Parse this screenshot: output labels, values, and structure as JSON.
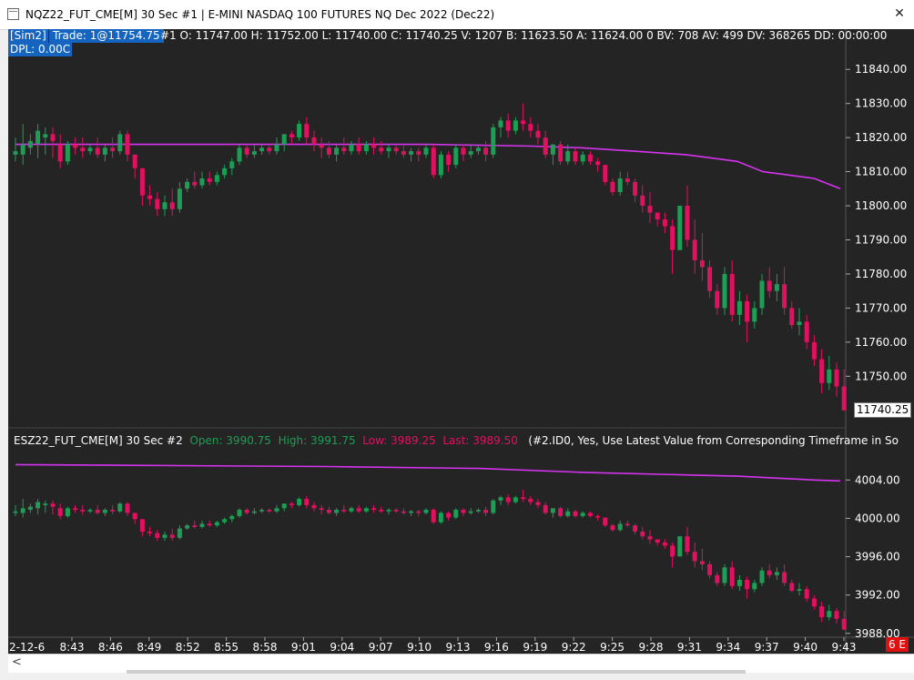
{
  "window": {
    "title": "NQZ22_FUT_CME[M]  30 Sec  #1 | E-MINI NASDAQ 100 FUTURES NQ Dec 2022 (Dec22)",
    "close_glyph": "✕"
  },
  "main_chart": {
    "account": "[Sim2]",
    "trade": "Trade: 1@11754.75",
    "dpl": "DPL: 0.00C",
    "ohlc_text": "#1 O: 11747.00 H: 11752.00 L: 11740.00 C: 11740.25 V: 1207 B: 11623.50 A: 11624.00 0 BV: 708 AV: 499 DV: 368265 DD: 00:00:00",
    "y_ticks": [
      "11840.00",
      "11830.00",
      "11820.00",
      "11810.00",
      "11800.00",
      "11790.00",
      "11780.00",
      "11770.00",
      "11760.00",
      "11750.00"
    ],
    "last_price": "11740.25"
  },
  "sub_chart": {
    "symbol": "ESZ22_FUT_CME[M]  30 Sec  #2",
    "open": "Open: 3990.75",
    "high": "High: 3991.75",
    "low": "Low: 3989.25",
    "last": "Last: 3989.50",
    "study": "(#2.ID0, Yes, Use Latest Value from Corresponding Timeframe in So",
    "y_ticks": [
      "4004.00",
      "4000.00",
      "3996.00",
      "3992.00",
      "3988.00"
    ]
  },
  "x_axis": {
    "date_label": "2-12-6",
    "times": [
      "8:43",
      "8:46",
      "8:49",
      "8:52",
      "8:55",
      "8:58",
      "9:01",
      "9:04",
      "9:07",
      "9:10",
      "9:13",
      "9:16",
      "9:19",
      "9:22",
      "9:25",
      "9:28",
      "9:31",
      "9:34",
      "9:37",
      "9:40",
      "9:43"
    ]
  },
  "status": {
    "badge": "6 E",
    "scroll_left_glyph": "<"
  },
  "colors": {
    "up": "#1e9e55",
    "down": "#e0115f",
    "ma": "#d633f0",
    "background": "#242424"
  },
  "chart_data": [
    {
      "type": "candlestick",
      "y_axis_range": [
        11737,
        11847
      ],
      "ma_line": [
        [
          0,
          11818
        ],
        [
          60,
          11818
        ],
        [
          80,
          11818
        ],
        [
          100,
          11817.5
        ],
        [
          110,
          11817
        ],
        [
          120,
          11816
        ],
        [
          130,
          11815
        ],
        [
          135,
          11814
        ],
        [
          140,
          11813
        ],
        [
          145,
          11810
        ],
        [
          150,
          11809
        ],
        [
          155,
          11808
        ],
        [
          160,
          11805
        ]
      ],
      "candles": [
        [
          0,
          11815,
          11820,
          11816,
          11813
        ],
        [
          1,
          11815,
          11824,
          11818,
          11812
        ],
        [
          2,
          11817,
          11821,
          11819,
          11815
        ],
        [
          3,
          11818,
          11824,
          11822,
          11814
        ],
        [
          4,
          11820,
          11823,
          11821,
          11815
        ],
        [
          5,
          11821,
          11823,
          11819,
          11814
        ],
        [
          6,
          11818,
          11821,
          11813,
          11811
        ],
        [
          7,
          11813,
          11819,
          11818,
          11812
        ],
        [
          8,
          11818,
          11820,
          11817,
          11815
        ],
        [
          9,
          11817,
          11820,
          11816,
          11814
        ],
        [
          10,
          11816,
          11818,
          11817,
          11815
        ],
        [
          11,
          11817,
          11820,
          11815,
          11814
        ],
        [
          12,
          11815,
          11818,
          11817,
          11813
        ],
        [
          13,
          11817,
          11820,
          11816,
          11814
        ],
        [
          14,
          11816,
          11822,
          11821,
          11815
        ],
        [
          15,
          11821,
          11822,
          11815,
          11813
        ],
        [
          16,
          11815,
          11815,
          11811,
          11808
        ],
        [
          17,
          11811,
          11811,
          11803,
          11800
        ],
        [
          18,
          11803,
          11806,
          11802,
          11800
        ],
        [
          19,
          11802,
          11804,
          11799,
          11797
        ],
        [
          20,
          11799,
          11803,
          11801,
          11797
        ],
        [
          21,
          11801,
          11805,
          11799,
          11797
        ],
        [
          22,
          11799,
          11807,
          11805,
          11798
        ],
        [
          23,
          11805,
          11808,
          11807,
          11804
        ],
        [
          24,
          11807,
          11810,
          11806,
          11805
        ],
        [
          25,
          11806,
          11810,
          11808,
          11805
        ],
        [
          26,
          11808,
          11810,
          11807,
          11806
        ],
        [
          27,
          11807,
          11810,
          11809,
          11806
        ],
        [
          28,
          11809,
          11812,
          11811,
          11808
        ],
        [
          29,
          11811,
          11814,
          11813,
          11809
        ],
        [
          30,
          11813,
          11818,
          11817,
          11812
        ],
        [
          31,
          11817,
          11818,
          11815,
          11814
        ],
        [
          32,
          11815,
          11818,
          11816,
          11814
        ],
        [
          33,
          11816,
          11818,
          11817,
          11815
        ],
        [
          34,
          11817,
          11818,
          11816,
          11815
        ],
        [
          35,
          11816,
          11820,
          11818,
          11815
        ],
        [
          36,
          11818,
          11820,
          11821,
          11816
        ],
        [
          37,
          11821,
          11822,
          11820,
          11818
        ],
        [
          38,
          11820,
          11825,
          11824,
          11819
        ],
        [
          39,
          11824,
          11826,
          11820,
          11818
        ],
        [
          40,
          11820,
          11822,
          11818,
          11816
        ],
        [
          41,
          11818,
          11820,
          11817,
          11814
        ],
        [
          42,
          11817,
          11819,
          11815,
          11814
        ],
        [
          43,
          11815,
          11818,
          11817,
          11813
        ],
        [
          44,
          11817,
          11820,
          11816,
          11815
        ],
        [
          45,
          11816,
          11819,
          11818,
          11815
        ],
        [
          46,
          11818,
          11820,
          11816,
          11815
        ],
        [
          47,
          11816,
          11819,
          11818,
          11815
        ],
        [
          48,
          11818,
          11820,
          11817,
          11815
        ],
        [
          49,
          11817,
          11819,
          11816,
          11815
        ],
        [
          50,
          11816,
          11818,
          11817,
          11814
        ],
        [
          51,
          11817,
          11818,
          11816,
          11815
        ],
        [
          52,
          11816,
          11818,
          11815,
          11814
        ],
        [
          53,
          11815,
          11817,
          11816,
          11813
        ],
        [
          54,
          11816,
          11817,
          11815,
          11813
        ],
        [
          55,
          11815,
          11818,
          11817,
          11814
        ],
        [
          56,
          11817,
          11818,
          11809,
          11808
        ],
        [
          57,
          11809,
          11816,
          11815,
          11808
        ],
        [
          58,
          11815,
          11816,
          11812,
          11810
        ],
        [
          59,
          11812,
          11818,
          11817,
          11811
        ],
        [
          60,
          11817,
          11818,
          11815,
          11813
        ],
        [
          61,
          11815,
          11818,
          11816,
          11814
        ],
        [
          62,
          11816,
          11818,
          11817,
          11815
        ],
        [
          63,
          11817,
          11819,
          11815,
          11813
        ],
        [
          64,
          11815,
          11824,
          11823,
          11814
        ],
        [
          65,
          11823,
          11826,
          11825,
          11820
        ],
        [
          66,
          11825,
          11827,
          11822,
          11820
        ],
        [
          67,
          11822,
          11826,
          11825,
          11821
        ],
        [
          68,
          11825,
          11830,
          11824,
          11822
        ],
        [
          69,
          11824,
          11826,
          11822,
          11820
        ],
        [
          70,
          11822,
          11824,
          11820,
          11818
        ],
        [
          71,
          11820,
          11822,
          11815,
          11814
        ],
        [
          72,
          11815,
          11818,
          11818,
          11812
        ],
        [
          73,
          11818,
          11819,
          11813,
          11812
        ],
        [
          74,
          11813,
          11818,
          11816,
          11812
        ],
        [
          75,
          11816,
          11817,
          11813,
          11812
        ],
        [
          76,
          11813,
          11816,
          11815,
          11812
        ],
        [
          77,
          11815,
          11816,
          11813,
          11812
        ],
        [
          78,
          11813,
          11814,
          11812,
          11810
        ],
        [
          79,
          11812,
          11812,
          11807,
          11806
        ],
        [
          80,
          11807,
          11808,
          11804,
          11803
        ],
        [
          81,
          11804,
          11810,
          11808,
          11803
        ],
        [
          82,
          11808,
          11810,
          11807,
          11806
        ],
        [
          83,
          11807,
          11808,
          11803,
          11801
        ],
        [
          84,
          11803,
          11806,
          11800,
          11798
        ],
        [
          85,
          11800,
          11804,
          11798,
          11795
        ],
        [
          86,
          11798,
          11798,
          11796,
          11794
        ],
        [
          87,
          11796,
          11798,
          11794,
          11792
        ],
        [
          88,
          11794,
          11796,
          11787,
          11780
        ],
        [
          89,
          11787,
          11788,
          11800,
          11787
        ],
        [
          90,
          11800,
          11806,
          11790,
          11788
        ],
        [
          91,
          11790,
          11796,
          11784,
          11780
        ],
        [
          92,
          11784,
          11792,
          11782,
          11778
        ],
        [
          93,
          11782,
          11784,
          11775,
          11773
        ],
        [
          94,
          11775,
          11777,
          11770,
          11768
        ],
        [
          95,
          11770,
          11782,
          11780,
          11768
        ],
        [
          96,
          11780,
          11784,
          11768,
          11766
        ],
        [
          97,
          11768,
          11775,
          11772,
          11765
        ],
        [
          98,
          11772,
          11774,
          11766,
          11760
        ],
        [
          99,
          11766,
          11772,
          11770,
          11764
        ],
        [
          100,
          11770,
          11780,
          11778,
          11768
        ],
        [
          101,
          11778,
          11782,
          11775,
          11773
        ],
        [
          102,
          11775,
          11780,
          11777,
          11772
        ],
        [
          103,
          11777,
          11782,
          11770,
          11768
        ],
        [
          104,
          11770,
          11772,
          11765,
          11764
        ],
        [
          105,
          11765,
          11770,
          11766,
          11762
        ],
        [
          106,
          11766,
          11768,
          11760,
          11758
        ],
        [
          107,
          11760,
          11762,
          11755,
          11753
        ],
        [
          108,
          11755,
          11758,
          11748,
          11745
        ],
        [
          109,
          11748,
          11756,
          11752,
          11746
        ],
        [
          110,
          11752,
          11754,
          11747,
          11744
        ],
        [
          111,
          11747,
          11752,
          11740,
          11740
        ]
      ]
    },
    {
      "type": "candlestick",
      "y_axis_range": [
        3987.6,
        4006.4
      ],
      "ma_line": [
        [
          0,
          4005.6
        ],
        [
          60,
          4005.4
        ],
        [
          90,
          4005.2
        ],
        [
          110,
          4004.8
        ],
        [
          125,
          4004.6
        ],
        [
          140,
          4004.4
        ],
        [
          155,
          4004.0
        ],
        [
          160,
          4003.9
        ]
      ],
      "candles_share_shape_with": "main"
    }
  ]
}
